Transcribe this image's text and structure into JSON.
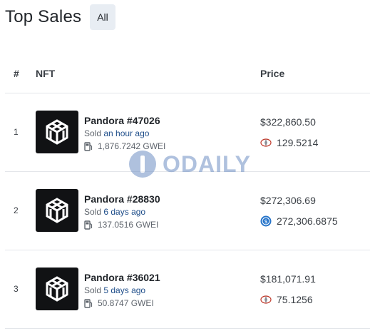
{
  "page": {
    "title": "Top Sales",
    "filter_label": "All"
  },
  "columns": {
    "rank": "#",
    "nft": "NFT",
    "price": "Price"
  },
  "watermark": "ODAILY",
  "sales": [
    {
      "rank": "1",
      "name": "Pandora #47026",
      "sold_prefix": "Sold",
      "sold_time": "an hour ago",
      "gas": "1,876.7242 GWEI",
      "usd_price": "$322,860.50",
      "token_amount": "129.5214",
      "token_icon": "eth-icon"
    },
    {
      "rank": "2",
      "name": "Pandora #28830",
      "sold_prefix": "Sold",
      "sold_time": "6 days ago",
      "gas": "137.0516 GWEI",
      "usd_price": "$272,306.69",
      "token_amount": "272,306.6875",
      "token_icon": "usdc-icon"
    },
    {
      "rank": "3",
      "name": "Pandora #36021",
      "sold_prefix": "Sold",
      "sold_time": "5 days ago",
      "gas": "50.8747 GWEI",
      "usd_price": "$181,071.91",
      "token_amount": "75.1256",
      "token_icon": "eth-icon"
    }
  ]
}
